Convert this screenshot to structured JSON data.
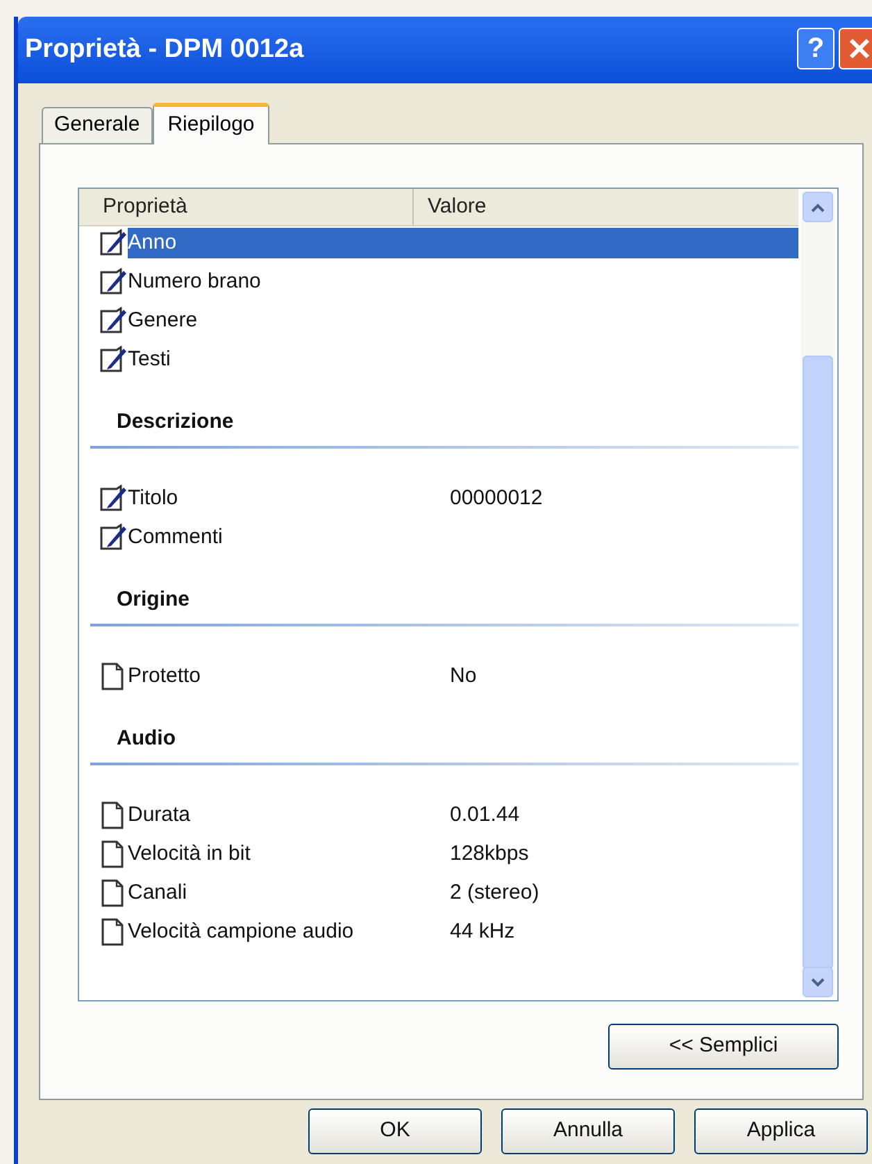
{
  "window": {
    "title": "Proprietà - DPM 0012a",
    "help_button": "?"
  },
  "tabs": [
    {
      "label": "Generale",
      "selected": false
    },
    {
      "label": "Riepilogo",
      "selected": true
    }
  ],
  "list": {
    "columns": [
      "Proprietà",
      "Valore"
    ],
    "rows": [
      {
        "kind": "editable",
        "name": "Anno",
        "selected": true
      },
      {
        "kind": "editable",
        "name": "Numero brano",
        "selected": false
      },
      {
        "kind": "editable",
        "name": "Genere",
        "selected": false
      },
      {
        "kind": "editable",
        "name": "Testi",
        "selected": false
      },
      {
        "kind": "group",
        "name": "Descrizione"
      },
      {
        "kind": "editable",
        "name": "Titolo",
        "value": "00000012",
        "selected": false
      },
      {
        "kind": "editable",
        "name": "Commenti",
        "selected": false
      },
      {
        "kind": "group",
        "name": "Origine"
      },
      {
        "kind": "readonly",
        "name": "Protetto",
        "value": "No",
        "selected": false
      },
      {
        "kind": "group",
        "name": "Audio"
      },
      {
        "kind": "readonly",
        "name": "Durata",
        "value": "0.01.44",
        "selected": false
      },
      {
        "kind": "readonly",
        "name": "Velocità in bit",
        "value": "128kbps",
        "selected": false
      },
      {
        "kind": "readonly",
        "name": "Canali",
        "value": "2 (stereo)",
        "selected": false
      },
      {
        "kind": "readonly",
        "name": "Velocità campione audio",
        "value": "44 kHz",
        "selected": false
      }
    ]
  },
  "toggle_button": "<< Semplici",
  "buttons": [
    "OK",
    "Annulla",
    "Applica"
  ]
}
